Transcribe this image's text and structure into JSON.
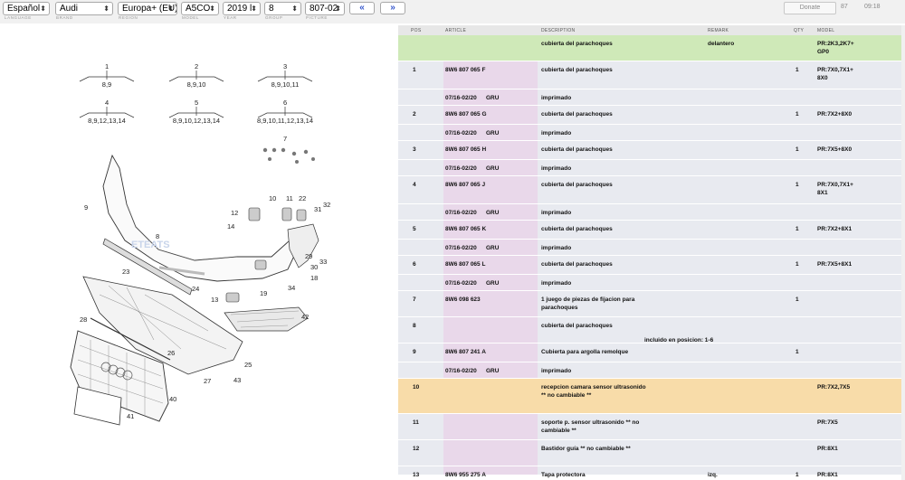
{
  "toolbar": {
    "language": "Español",
    "brand": "Audi",
    "region": "Europa+ (EU)",
    "model": "A5CO",
    "year": "2019 Ɩ",
    "group": "8",
    "picture": "807-02",
    "prev_label": "«",
    "next_label": "»",
    "donate_label": "Donate",
    "counter_a": "87",
    "counter_b": "09:18",
    "labels": {
      "language": "LANGUAGE",
      "brand": "BRAND",
      "region": "REGION",
      "model": "MODEL",
      "year": "YEAR",
      "group": "GROUP",
      "picture": "PICTURE"
    }
  },
  "diagram": {
    "groups": [
      {
        "num": "1",
        "sub": "8,9"
      },
      {
        "num": "2",
        "sub": "8,9,10"
      },
      {
        "num": "3",
        "sub": "8,9,10,11"
      },
      {
        "num": "4",
        "sub": "8,9,12,13,14"
      },
      {
        "num": "5",
        "sub": "8,9,10,12,13,14"
      },
      {
        "num": "6",
        "sub": "8,9,10,11,12,13,14"
      }
    ],
    "callouts": [
      "7",
      "8",
      "9",
      "10",
      "11",
      "22",
      "12",
      "14",
      "32",
      "31",
      "33",
      "30",
      "29",
      "24",
      "23",
      "18",
      "34",
      "13",
      "19",
      "42",
      "28",
      "26",
      "25",
      "27",
      "43",
      "40",
      "41"
    ],
    "watermark": "ETEATS"
  },
  "table": {
    "headers": {
      "pos": "POS",
      "article": "ARTICLE",
      "description": "DESCRIPTION",
      "remark": "REMARK",
      "qty": "QTY",
      "model": "MODEL"
    },
    "rows": [
      {
        "type": "green",
        "pos": "",
        "article": "",
        "date": "",
        "group": "",
        "desc": "cubierta del parachoques",
        "remark": "delantero",
        "qty": "",
        "model": "PR:2K3,2K7+ GP0",
        "note": ""
      },
      {
        "type": "main",
        "pos": "1",
        "article": "8W6 807 065 F",
        "date": "",
        "group": "",
        "desc": "cubierta del parachoques",
        "remark": "",
        "qty": "1",
        "model": "PR:7X0,7X1+ 8X0",
        "note": ""
      },
      {
        "type": "sub",
        "pos": "",
        "article": "",
        "date": "07/16-02/20",
        "group": "GRU",
        "desc": "imprimado",
        "remark": "",
        "qty": "",
        "model": "",
        "note": ""
      },
      {
        "type": "main",
        "pos": "2",
        "article": "8W6 807 065 G",
        "date": "",
        "group": "",
        "desc": "cubierta del parachoques",
        "remark": "",
        "qty": "1",
        "model": "PR:7X2+8X0",
        "note": ""
      },
      {
        "type": "sub",
        "pos": "",
        "article": "",
        "date": "07/16-02/20",
        "group": "GRU",
        "desc": "imprimado",
        "remark": "",
        "qty": "",
        "model": "",
        "note": ""
      },
      {
        "type": "main",
        "pos": "3",
        "article": "8W6 807 065 H",
        "date": "",
        "group": "",
        "desc": "cubierta del parachoques",
        "remark": "",
        "qty": "1",
        "model": "PR:7X5+8X0",
        "note": ""
      },
      {
        "type": "sub",
        "pos": "",
        "article": "",
        "date": "07/16-02/20",
        "group": "GRU",
        "desc": "imprimado",
        "remark": "",
        "qty": "",
        "model": "",
        "note": ""
      },
      {
        "type": "main",
        "pos": "4",
        "article": "8W6 807 065 J",
        "date": "",
        "group": "",
        "desc": "cubierta del parachoques",
        "remark": "",
        "qty": "1",
        "model": "PR:7X0,7X1+ 8X1",
        "note": ""
      },
      {
        "type": "sub",
        "pos": "",
        "article": "",
        "date": "07/16-02/20",
        "group": "GRU",
        "desc": "imprimado",
        "remark": "",
        "qty": "",
        "model": "",
        "note": ""
      },
      {
        "type": "main",
        "pos": "5",
        "article": "8W6 807 065 K",
        "date": "",
        "group": "",
        "desc": "cubierta del parachoques",
        "remark": "",
        "qty": "1",
        "model": "PR:7X2+8X1",
        "note": ""
      },
      {
        "type": "sub",
        "pos": "",
        "article": "",
        "date": "07/16-02/20",
        "group": "GRU",
        "desc": "imprimado",
        "remark": "",
        "qty": "",
        "model": "",
        "note": ""
      },
      {
        "type": "main",
        "pos": "6",
        "article": "8W6 807 065 L",
        "date": "",
        "group": "",
        "desc": "cubierta del parachoques",
        "remark": "",
        "qty": "1",
        "model": "PR:7X5+8X1",
        "note": ""
      },
      {
        "type": "sub",
        "pos": "",
        "article": "",
        "date": "07/16-02/20",
        "group": "GRU",
        "desc": "imprimado",
        "remark": "",
        "qty": "",
        "model": "",
        "note": ""
      },
      {
        "type": "main",
        "pos": "7",
        "article": "8W6 098 623",
        "date": "",
        "group": "",
        "desc": "1 juego de piezas de fijacion para parachoques",
        "remark": "",
        "qty": "1",
        "model": "",
        "note": ""
      },
      {
        "type": "main",
        "pos": "8",
        "article": "",
        "date": "",
        "group": "",
        "desc": "cubierta del parachoques",
        "remark": "",
        "qty": "",
        "model": "",
        "note": "incluido en posicion:  1-6"
      },
      {
        "type": "main",
        "pos": "9",
        "article": "8W6 807 241 A",
        "date": "",
        "group": "",
        "desc": "Cubierta para argolla remolque",
        "remark": "",
        "qty": "1",
        "model": "",
        "note": ""
      },
      {
        "type": "sub",
        "pos": "",
        "article": "",
        "date": "07/16-02/20",
        "group": "GRU",
        "desc": "imprimado",
        "remark": "",
        "qty": "",
        "model": "",
        "note": ""
      },
      {
        "type": "orange",
        "pos": "10",
        "article": "",
        "date": "",
        "group": "",
        "desc": "recepcion camara sensor ultrasonido ** no cambiable **",
        "remark": "",
        "qty": "",
        "model": "PR:7X2,7X5",
        "note": ""
      },
      {
        "type": "main",
        "pos": "11",
        "article": "",
        "date": "",
        "group": "",
        "desc": "soporte p. sensor ultrasonido ** no cambiable **",
        "remark": "",
        "qty": "",
        "model": "PR:7X5",
        "note": ""
      },
      {
        "type": "main",
        "pos": "12",
        "article": "",
        "date": "",
        "group": "",
        "desc": "Bastidor guía ** no cambiable **",
        "remark": "",
        "qty": "",
        "model": "PR:8X1",
        "note": ""
      },
      {
        "type": "main",
        "pos": "13",
        "article": "8W6 955 275 A",
        "date": "",
        "group": "",
        "desc": "Tapa protectora",
        "remark": "izq.",
        "qty": "1",
        "model": "PR:8X1",
        "note": ""
      }
    ]
  },
  "colors": {
    "green_row": "#cfe9b8",
    "orange_row": "#f8dca9",
    "row_bg": "#e8eaf0",
    "article_bg": "#e9d8ea",
    "nav_blue": "#3355cc"
  }
}
